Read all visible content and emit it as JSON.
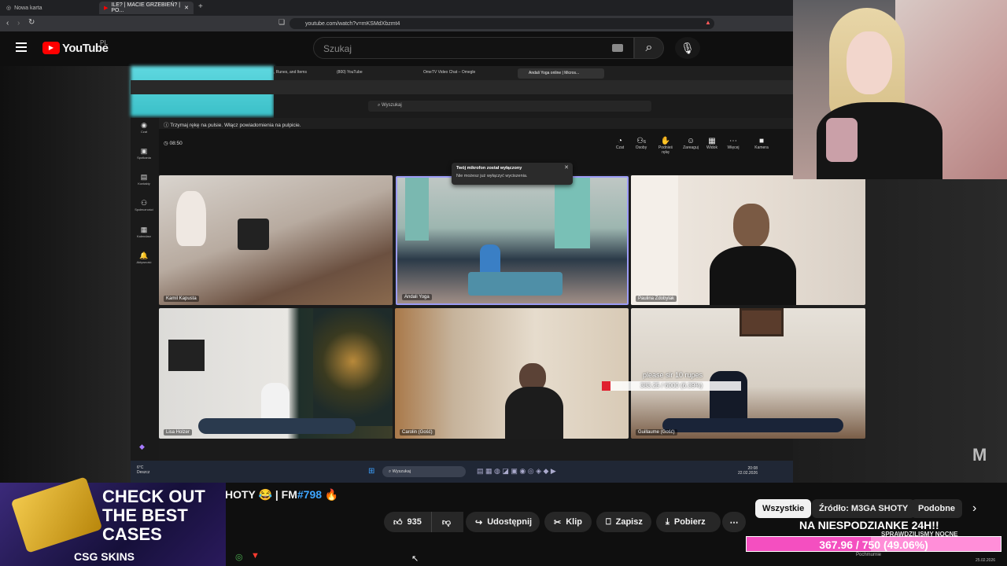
{
  "browser": {
    "tabs": [
      {
        "label": "Nowa karta",
        "active": false
      },
      {
        "label": "ILE? | MACIE GRZEBIEŃ? | PO...",
        "active": true
      }
    ],
    "new_tab": "+",
    "url": "youtube.com/watch?v=mKSMdXbzmt4"
  },
  "youtube": {
    "logo_text": "YouTube",
    "logo_region": "PL",
    "search_placeholder": "Szukaj",
    "video_title_fragment": "HOTY 😂 | FM",
    "video_number": "#798",
    "fire": "🔥",
    "actions": {
      "likes": "935",
      "share": "Udostępnij",
      "clip": "Klip",
      "save": "Zapisz",
      "download": "Pobierz"
    },
    "chips": [
      "Wszystkie",
      "Źródło: M3GA SHOTY",
      "Podobne"
    ],
    "recommend_title": "NA NIESPODZIANKE 24H!!",
    "recommend_sub": "SPRAWDZILISMY NOCNE"
  },
  "inner_screen": {
    "tabs": [
      ", Runes, and Items",
      "(800) YouTube",
      "OmeTV Video Chat – Omegle",
      "Andali Yoga online | Micros..."
    ],
    "search": "Wyszukaj",
    "notification": "Trzymaj rękę na pulsie. Włącz powiadomienia na pulpicie.",
    "timer": "08:50",
    "sidebar": [
      "Czat",
      "Spotkania",
      "Kontakty",
      "Społeczności",
      "Kalendarz",
      "Aktywność"
    ],
    "toolbar": [
      "Czat",
      "Osoby",
      "Podnieś rękę",
      "Zareaguj",
      "Widok",
      "Więcej",
      "Kamera"
    ],
    "people_count": "6",
    "mic_toast": {
      "title": "Twój mikrofon został wyłączony",
      "body": "Nie możesz już wyłączyć wyciszenia."
    },
    "participants": [
      "Kamil Kapusta",
      "Andali Yoga",
      "Paulina Zdobylak",
      "Lisa Holzer",
      "Carolin (Gość)",
      "Guillaume (Gość)"
    ],
    "donation_msg": "please sir 10 rupes",
    "donation_progress": "383.25 / 6000 (6.39%)",
    "donation_fraction": 0.0639,
    "taskbar_weather_temp": "6°C",
    "taskbar_weather_desc": "Deszcz",
    "taskbar_search": "Wyszukaj",
    "taskbar_time": "20:08",
    "taskbar_date": "22.02.2026"
  },
  "overlay": {
    "ad_text": "CHECK OUT THE BEST CASES",
    "ad_brand": "CSG SKINS",
    "goal_text": "367.96 / 750 (49.06%)",
    "goal_fraction": 0.4906,
    "host_weather": "Pochmurnie",
    "host_date": "25.02.2026",
    "watermark": "M"
  }
}
